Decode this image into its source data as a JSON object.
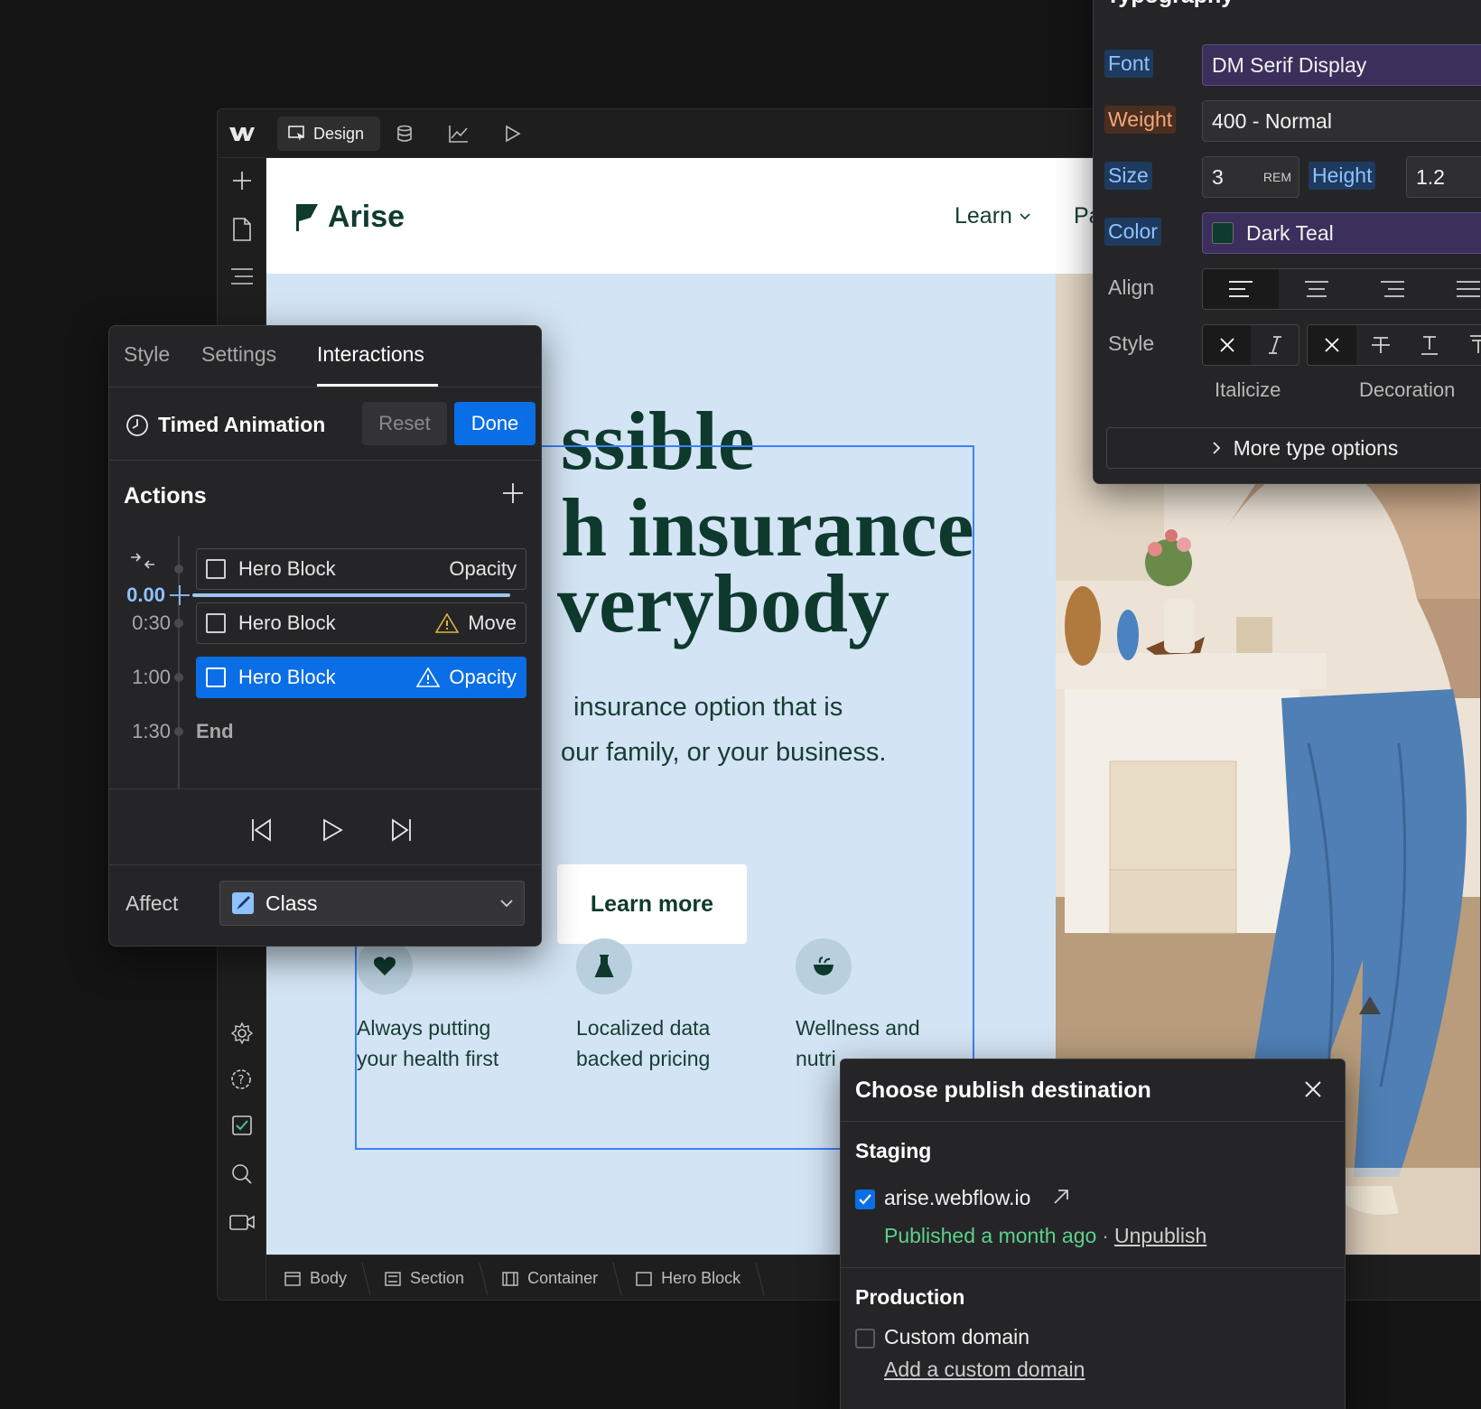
{
  "toolbar": {
    "design_label": "Design"
  },
  "site": {
    "brand": "Arise",
    "nav": {
      "learn": "Learn",
      "partial": "Pa"
    },
    "headline": [
      "ssible",
      "h insurance",
      "verybody"
    ],
    "subtitle": [
      "insurance option that is",
      "our family, or your business."
    ],
    "cta": "Learn more",
    "features": [
      {
        "icon": "heart-icon",
        "line1": "Always putting",
        "line2": "your health first"
      },
      {
        "icon": "flask-icon",
        "line1": "Localized data",
        "line2": "backed pricing"
      },
      {
        "icon": "bowl-icon",
        "line1": "Wellness and",
        "line2": "nutri"
      }
    ]
  },
  "breadcrumbs": [
    "Body",
    "Section",
    "Container",
    "Hero Block"
  ],
  "interactions": {
    "tabs": [
      "Style",
      "Settings",
      "Interactions"
    ],
    "active_tab": "Interactions",
    "animation_name": "Timed Animation",
    "reset_label": "Reset",
    "done_label": "Done",
    "actions_title": "Actions",
    "current_time": "0.00",
    "rows": [
      {
        "target": "Hero Block",
        "action": "Opacity"
      },
      {
        "time": "0:30",
        "target": "Hero Block",
        "action": "Move",
        "warning": true
      },
      {
        "time": "1:00",
        "target": "Hero Block",
        "action": "Opacity",
        "warning": true,
        "selected": true
      }
    ],
    "end_time": "1:30",
    "end_label": "End",
    "affect_label": "Affect",
    "affect_value": "Class"
  },
  "typography": {
    "title": "Typography",
    "font_label": "Font",
    "font_value": "DM Serif Display",
    "weight_label": "Weight",
    "weight_value": "400 - Normal",
    "size_label": "Size",
    "size_value": "3",
    "size_unit": "REM",
    "height_label": "Height",
    "height_value": "1.2",
    "color_label": "Color",
    "color_value": "Dark Teal",
    "color_swatch": "#0f3b2f",
    "align_label": "Align",
    "style_label": "Style",
    "italicize_label": "Italicize",
    "decoration_label": "Decoration",
    "more_label": "More type options"
  },
  "publish": {
    "title": "Choose publish destination",
    "staging_label": "Staging",
    "staging_domain": "arise.webflow.io",
    "staging_checked": true,
    "published_status": "Published a month ago",
    "separator": "·",
    "unpublish_label": "Unpublish",
    "production_label": "Production",
    "custom_domain_label": "Custom domain",
    "add_domain_label": "Add a custom domain"
  },
  "colors": {
    "accent": "#0a6ee6",
    "brand_dark_teal": "#0f3b2f",
    "hero_bg": "#d3e4f4",
    "published_green": "#5ecf8c"
  }
}
